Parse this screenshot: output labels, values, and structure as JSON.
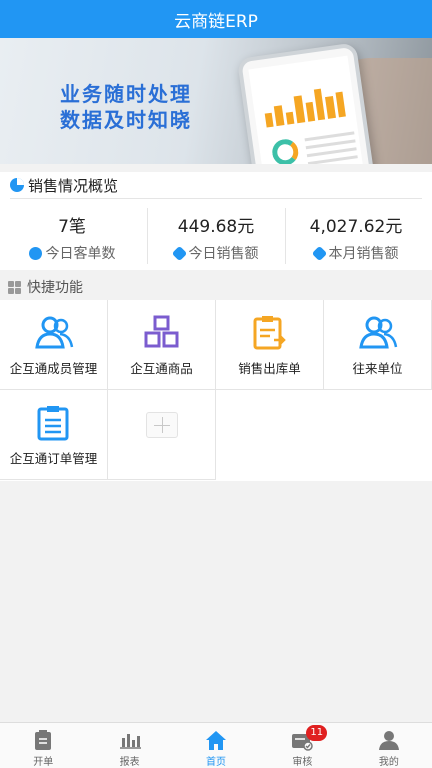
{
  "app": {
    "title": "云商链ERP"
  },
  "banner": {
    "line1": "业务随时处理",
    "line2": "数据及时知晓",
    "slide_count": 2,
    "active_slide": 1
  },
  "overview": {
    "title": "销售情况概览",
    "stats": [
      {
        "value": "7笔",
        "label": "今日客单数",
        "icon": "trend-icon"
      },
      {
        "value": "449.68元",
        "label": "今日销售额",
        "icon": "tag-icon"
      },
      {
        "value": "4,027.62元",
        "label": "本月销售额",
        "icon": "tag-icon"
      }
    ]
  },
  "quick": {
    "title": "快捷功能",
    "items": [
      {
        "label": "企互通成员管理",
        "icon": "members-icon"
      },
      {
        "label": "企互通商品",
        "icon": "boxes-icon"
      },
      {
        "label": "销售出库单",
        "icon": "outbound-doc-icon"
      },
      {
        "label": "往来单位",
        "icon": "contacts-icon"
      },
      {
        "label": "企互通订单管理",
        "icon": "order-clipboard-icon"
      }
    ]
  },
  "tabbar": {
    "tabs": [
      {
        "label": "开单",
        "icon": "clipboard-icon"
      },
      {
        "label": "报表",
        "icon": "bar-chart-icon"
      },
      {
        "label": "首页",
        "icon": "home-icon",
        "active": true
      },
      {
        "label": "审核",
        "icon": "review-icon",
        "badge": "11"
      },
      {
        "label": "我的",
        "icon": "user-icon"
      }
    ]
  },
  "colors": {
    "primary": "#2196f3",
    "purple": "#7b5ccf",
    "orange": "#f5a623",
    "badge": "#e02020"
  }
}
